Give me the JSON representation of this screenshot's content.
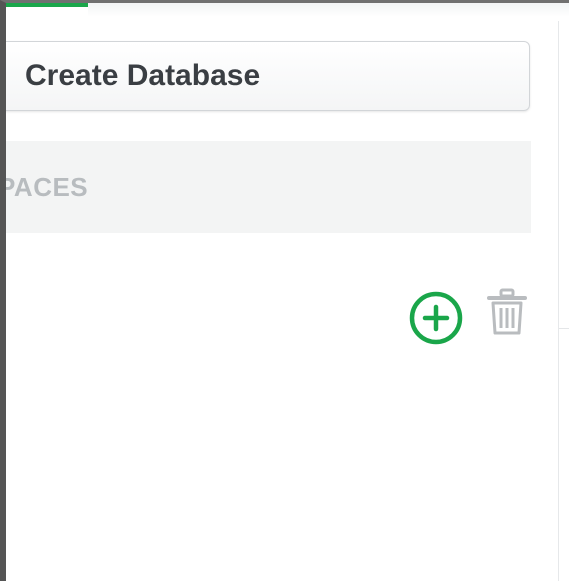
{
  "sidebar": {
    "create_database_label": "Create Database",
    "section_label": "PACES",
    "actions": {
      "add_icon": "plus-circle-icon",
      "delete_icon": "trash-icon"
    }
  },
  "colors": {
    "accent": "#1aa64a",
    "icon_muted": "#b9bcbf",
    "text_dark": "#3a3e43",
    "text_muted": "#b8bcbf"
  }
}
